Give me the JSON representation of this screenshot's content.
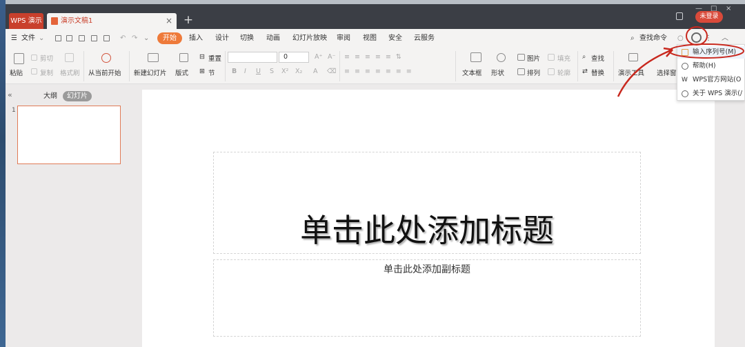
{
  "title_bar": {
    "wps_tab": "WPS 演示",
    "doc_tab": "演示文稿1",
    "close_tab": "×",
    "new_tab": "+",
    "login": "未登录",
    "controls": [
      "—",
      "□",
      "×"
    ]
  },
  "menu": {
    "file": "文件",
    "items": [
      "开始",
      "插入",
      "设计",
      "切换",
      "动画",
      "幻灯片放映",
      "审阅",
      "视图",
      "安全",
      "云服务"
    ],
    "active": "开始",
    "search": "查找命令"
  },
  "ribbon": {
    "paste": "粘贴",
    "cut": "剪切",
    "copy": "复制",
    "format_painter": "格式刷",
    "from_current": "从当前开始",
    "new_slide": "新建幻灯片",
    "layout": "版式",
    "reset": "重置",
    "section": "节",
    "font_size": "0",
    "text_box": "文本框",
    "shape": "形状",
    "picture": "图片",
    "arrange": "排列",
    "fill": "填充",
    "outline": "轮廓",
    "find": "查找",
    "replace": "替换",
    "present_tools": "演示工具",
    "select": "选择窗"
  },
  "left_pane": {
    "collapse": "«",
    "tab_outline": "大纲",
    "tab_slides": "幻灯片",
    "slide_number": "1"
  },
  "slide": {
    "title": "单击此处添加标题",
    "subtitle": "单击此处添加副标题"
  },
  "dropdown": {
    "items": [
      "输入序列号(M)",
      "帮助(H)",
      "WPS官方网站(O",
      "关于 WPS 演示(/"
    ]
  },
  "colors": {
    "accent": "#ee7a3a",
    "title_bar": "#3b3e45",
    "annotation": "#c8281e"
  }
}
